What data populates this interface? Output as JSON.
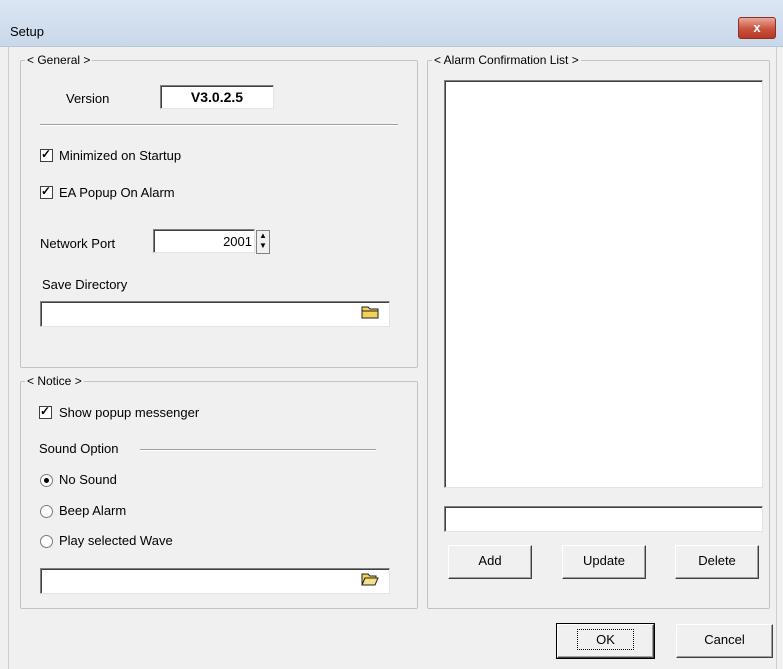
{
  "window": {
    "title": "Setup",
    "close_glyph": "x"
  },
  "general": {
    "legend": "< General >",
    "version_label": "Version",
    "version_value": "V3.0.2.5",
    "minimized_label": "Minimized on Startup",
    "minimized_checked": true,
    "popup_label": "EA Popup On Alarm",
    "popup_checked": true,
    "port_label": "Network Port",
    "port_value": "2001",
    "save_dir_label": "Save Directory",
    "save_dir_value": ""
  },
  "notice": {
    "legend": "< Notice >",
    "show_popup_label": "Show popup messenger",
    "show_popup_checked": true,
    "sound_option_label": "Sound Option",
    "options": [
      "No Sound",
      "Beep Alarm",
      "Play selected Wave"
    ],
    "selected_option": "No Sound",
    "wave_path_value": ""
  },
  "alarm_list": {
    "legend": "< Alarm Confirmation List >",
    "items": [],
    "entry_value": "",
    "add_label": "Add",
    "update_label": "Update",
    "delete_label": "Delete"
  },
  "footer": {
    "ok_label": "OK",
    "cancel_label": "Cancel"
  }
}
